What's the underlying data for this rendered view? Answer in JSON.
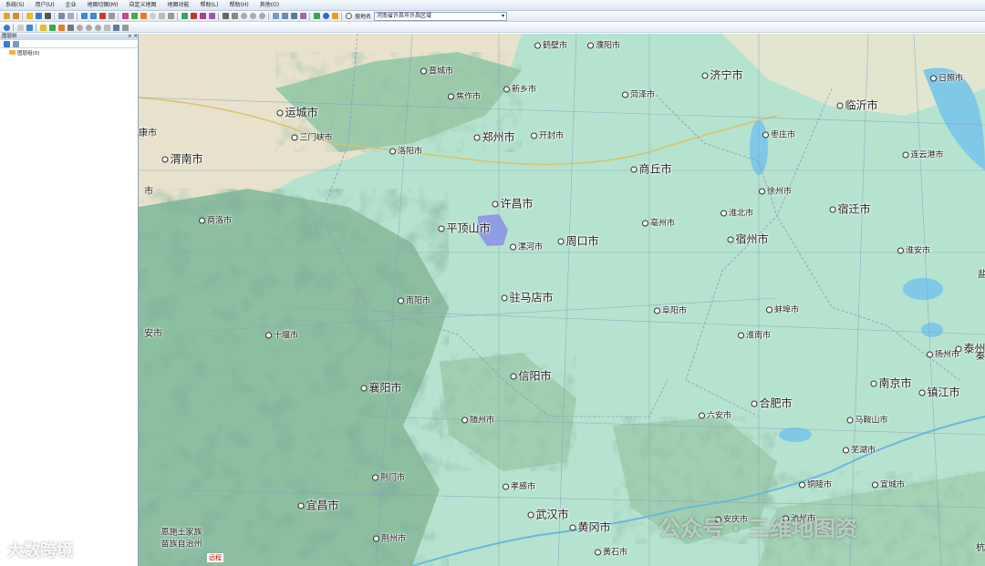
{
  "menu": [
    "系统(S)",
    "用户(U)",
    "企业",
    "地图切图(M)",
    "自定义地图",
    "地图功能",
    "帮助(L)",
    "帮助(H)",
    "其他(O)"
  ],
  "search": {
    "label": "搜地名",
    "value": "河南省许昌市许昌区域",
    "arrow": "▾"
  },
  "panel": {
    "title": "图层树",
    "close": "× ✕",
    "tree_item": "图层组(0)"
  },
  "cities": [
    {
      "name": "鹤壁市",
      "big": false
    },
    {
      "name": "濮阳市",
      "big": false
    },
    {
      "name": "晋城市",
      "big": false
    },
    {
      "name": "日照市",
      "big": false
    },
    {
      "name": "济宁市",
      "big": true
    },
    {
      "name": "新乡市",
      "big": false
    },
    {
      "name": "焦作市",
      "big": false
    },
    {
      "name": "菏泽市",
      "big": false
    },
    {
      "name": "临沂市",
      "big": true
    },
    {
      "name": "运城市",
      "big": true
    },
    {
      "name": "三门峡市",
      "big": false
    },
    {
      "name": "郑州市",
      "big": true
    },
    {
      "name": "开封市",
      "big": false
    },
    {
      "name": "枣庄市",
      "big": false
    },
    {
      "name": "洛阳市",
      "big": false
    },
    {
      "name": "渭南市",
      "big": true
    },
    {
      "name": "连云港市",
      "big": false
    },
    {
      "name": "商丘市",
      "big": true
    },
    {
      "name": "许昌市",
      "big": true
    },
    {
      "name": "徐州市",
      "big": false
    },
    {
      "name": "宿迁市",
      "big": true
    },
    {
      "name": "商洛市",
      "big": false
    },
    {
      "name": "平顶山市",
      "big": true
    },
    {
      "name": "淮北市",
      "big": false
    },
    {
      "name": "亳州市",
      "big": false
    },
    {
      "name": "宿州市",
      "big": true
    },
    {
      "name": "漯河市",
      "big": false
    },
    {
      "name": "周口市",
      "big": true
    },
    {
      "name": "淮安市",
      "big": false
    },
    {
      "name": "驻马店市",
      "big": true
    },
    {
      "name": "南阳市",
      "big": false
    },
    {
      "name": "蚌埠市",
      "big": false
    },
    {
      "name": "阜阳市",
      "big": false
    },
    {
      "name": "十堰市",
      "big": false
    },
    {
      "name": "淮南市",
      "big": false
    },
    {
      "name": "扬州市",
      "big": false
    },
    {
      "name": "泰州",
      "big": true
    },
    {
      "name": "信阳市",
      "big": true
    },
    {
      "name": "南京市",
      "big": true
    },
    {
      "name": "镇江市",
      "big": true
    },
    {
      "name": "襄阳市",
      "big": true
    },
    {
      "name": "六安市",
      "big": false
    },
    {
      "name": "合肥市",
      "big": true
    },
    {
      "name": "随州市",
      "big": false
    },
    {
      "name": "马鞍山市",
      "big": false
    },
    {
      "name": "芜湖市",
      "big": false
    },
    {
      "name": "荆门市",
      "big": false
    },
    {
      "name": "孝感市",
      "big": false
    },
    {
      "name": "铜陵市",
      "big": false
    },
    {
      "name": "宣城市",
      "big": false
    },
    {
      "name": "宜昌市",
      "big": true
    },
    {
      "name": "武汉市",
      "big": true
    },
    {
      "name": "黄冈市",
      "big": true
    },
    {
      "name": "安庆市",
      "big": false
    },
    {
      "name": "池州市",
      "big": false
    },
    {
      "name": "荆州市",
      "big": false
    },
    {
      "name": "黄石市",
      "big": false
    },
    {
      "name": "恩施土家族",
      "big": false
    },
    {
      "name": "苗族自治州",
      "big": false
    }
  ],
  "edge_labels": [
    "市",
    "安市",
    "康市",
    "盐",
    "秦州",
    "杭"
  ],
  "scale": "远程",
  "watermarks": {
    "left": "大数跨境",
    "right": "公众号 · 三维地图资"
  },
  "colors": {
    "plain": "#b5e3cf",
    "mountain": "#6fa58a",
    "highland": "#e8e2cc",
    "water": "#7fc8e8",
    "highlight": "#8a8fe8"
  }
}
